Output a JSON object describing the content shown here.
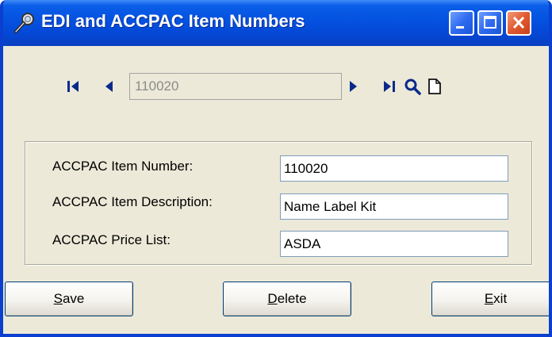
{
  "window": {
    "title": "EDI and ACCPAC Item Numbers",
    "controls": [
      "minimize",
      "maximize",
      "close"
    ]
  },
  "navigator": {
    "record_value": "110020",
    "icons": [
      "first-record-icon",
      "previous-record-icon",
      "next-record-icon",
      "last-record-icon",
      "search-icon",
      "new-record-icon"
    ]
  },
  "form": {
    "item_number_label": "ACCPAC Item Number:",
    "item_number_value": "110020",
    "item_description_label": "ACCPAC Item Description:",
    "item_description_value": "Name Label Kit",
    "price_list_label": "ACCPAC Price List:",
    "price_list_value": "ASDA"
  },
  "buttons": {
    "save_accel": "S",
    "save_rest": "ave",
    "delete_accel": "D",
    "delete_rest": "elete",
    "exit_accel": "E",
    "exit_rest": "xit"
  },
  "colors": {
    "titlebar": "#0551e0",
    "window_bg": "#ece9d8",
    "nav_icon": "#0a2a8a"
  }
}
